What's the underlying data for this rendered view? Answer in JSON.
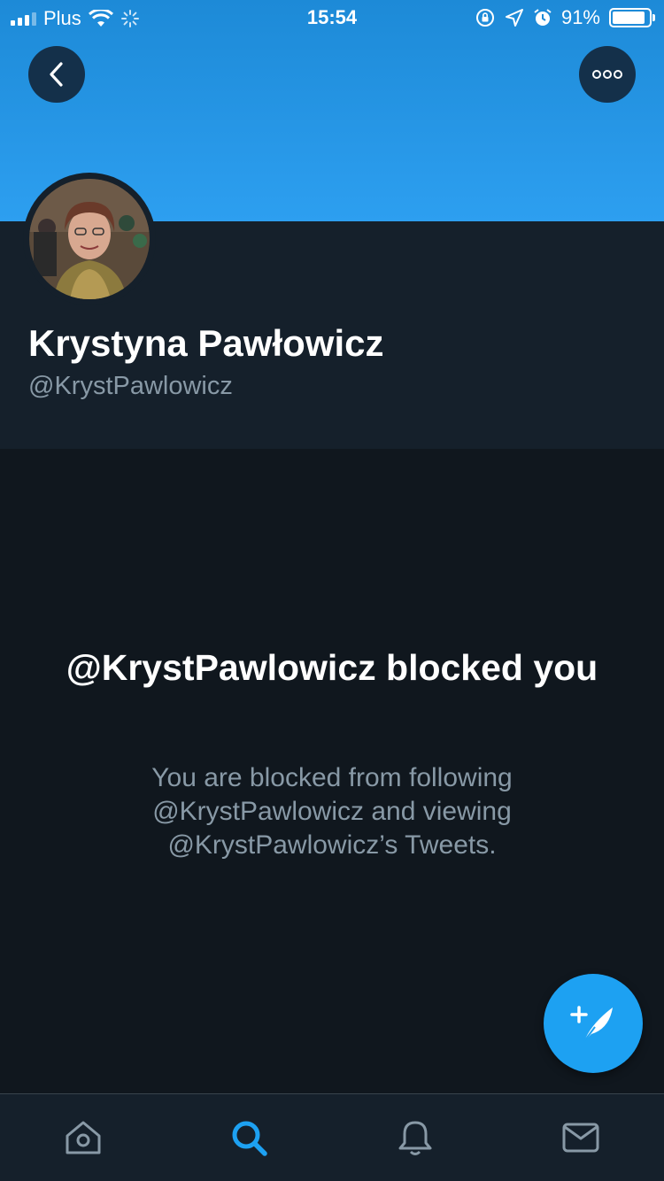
{
  "status_bar": {
    "carrier": "Plus",
    "time": "15:54",
    "battery_percent_label": "91%",
    "battery_level": 0.91
  },
  "profile": {
    "display_name": "Krystyna Pawłowicz",
    "handle": "@KrystPawlowicz"
  },
  "blocked": {
    "title": "@KrystPawlowicz blocked you",
    "description": "You are blocked from following @KrystPawlowicz and viewing @KrystPawlowicz’s Tweets."
  },
  "icons": {
    "back": "chevron-left-icon",
    "more": "more-icon",
    "compose": "compose-tweet-icon",
    "tabs": [
      "home-icon",
      "search-icon",
      "notifications-icon",
      "messages-icon"
    ]
  },
  "colors": {
    "banner": "#1d8ad7",
    "accent": "#1da1f2",
    "background": "#10171e",
    "panel": "#15202b",
    "secondary_text": "#8899a6"
  }
}
